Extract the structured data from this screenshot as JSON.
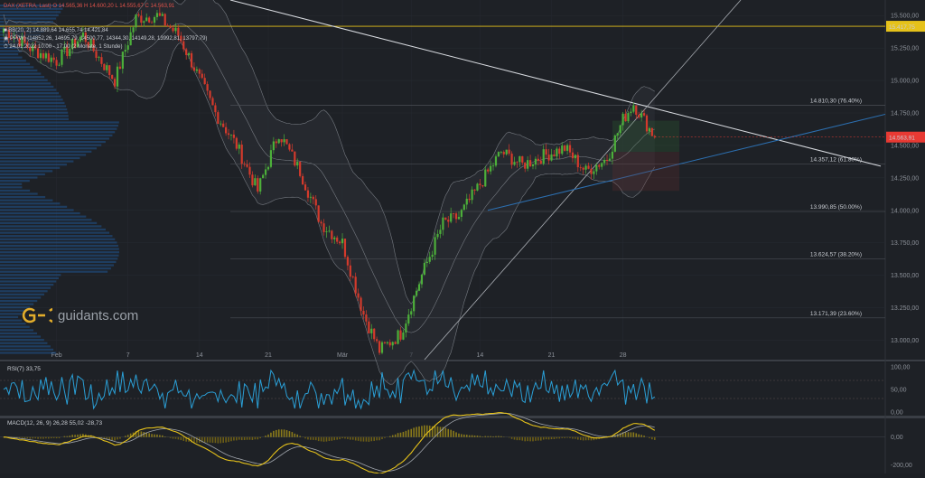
{
  "legend": {
    "symbol": "DAX (XETRA, Last)",
    "ohlc": "O 14.565,36  H 14.600,20  L 14.555,67  C 14.563,91",
    "bb": "BB(20, 2)  14.889,64  14.655,74  14.421,84",
    "pp": "PP(W)  (14852,26, 14695,79, 14500,77, 14344,30, 14149,28, 13992,81, 13797,79)",
    "range": "24.01.2022 10:00 - 17:00  (2 Monate, 1 Stunde)"
  },
  "watermark": "guidants.com",
  "colors": {
    "bull": "#4caf3a",
    "bear": "#d33a2c",
    "rsi": "#2a9fd6",
    "macd": "#e6c21a",
    "signal": "#9fa4ab",
    "bb": "#8b9097",
    "hline": "#e6c21a",
    "price_box": "#e83a33"
  },
  "chart_data": [
    {
      "type": "candlestick",
      "title": "DAX (XETRA, Last)",
      "ylim": [
        12850,
        15620
      ],
      "x_tick_labels": [
        "Feb",
        "7",
        "14",
        "21",
        "Mär",
        "7",
        "14",
        "21",
        "28"
      ],
      "y_tick_labels": [
        "15.500,00",
        "15.250,00",
        "15.000,00",
        "14.750,00",
        "14.500,00",
        "14.250,00",
        "14.000,00",
        "13.750,00",
        "13.500,00",
        "13.250,00",
        "13.000,00"
      ],
      "y_ticks": [
        15500,
        15250,
        15000,
        14750,
        14500,
        14250,
        14000,
        13750,
        13500,
        13250,
        13000
      ],
      "key_points": [
        {
          "i": 0,
          "v": 15400
        },
        {
          "i": 10,
          "v": 15250
        },
        {
          "i": 20,
          "v": 15150
        },
        {
          "i": 30,
          "v": 15350
        },
        {
          "i": 42,
          "v": 15000
        },
        {
          "i": 50,
          "v": 15480
        },
        {
          "i": 58,
          "v": 15500
        },
        {
          "i": 66,
          "v": 15350
        },
        {
          "i": 72,
          "v": 15100
        },
        {
          "i": 80,
          "v": 14750
        },
        {
          "i": 88,
          "v": 14500
        },
        {
          "i": 96,
          "v": 14150
        },
        {
          "i": 104,
          "v": 14600
        },
        {
          "i": 112,
          "v": 14300
        },
        {
          "i": 120,
          "v": 13900
        },
        {
          "i": 128,
          "v": 13750
        },
        {
          "i": 136,
          "v": 13200
        },
        {
          "i": 142,
          "v": 12920
        },
        {
          "i": 150,
          "v": 13050
        },
        {
          "i": 158,
          "v": 13500
        },
        {
          "i": 166,
          "v": 13900
        },
        {
          "i": 172,
          "v": 13950
        },
        {
          "i": 180,
          "v": 14200
        },
        {
          "i": 188,
          "v": 14450
        },
        {
          "i": 196,
          "v": 14350
        },
        {
          "i": 204,
          "v": 14420
        },
        {
          "i": 212,
          "v": 14480
        },
        {
          "i": 220,
          "v": 14300
        },
        {
          "i": 228,
          "v": 14400
        },
        {
          "i": 234,
          "v": 14700
        },
        {
          "i": 238,
          "v": 14820
        },
        {
          "i": 246,
          "v": 14564
        }
      ],
      "hlines": [
        {
          "label": "15.417,75",
          "value": 15417.75
        }
      ],
      "fib_levels": [
        {
          "label": "14.810,30 (76.40%)",
          "value": 14810.3
        },
        {
          "label": "14.357,12 (61.80%)",
          "value": 14357.12
        },
        {
          "label": "13.990,85 (50.00%)",
          "value": 13990.85
        },
        {
          "label": "13.624,57 (38.20%)",
          "value": 13624.57
        },
        {
          "label": "13.171,39 (23.60%)",
          "value": 13171.39
        }
      ],
      "last_price": {
        "label": "14.563,91",
        "value": 14563.91
      }
    },
    {
      "type": "line",
      "title": "RSI(7)  33,75",
      "series": [
        {
          "name": "RSI(7)",
          "last": 33.75
        }
      ],
      "ylim": [
        0,
        100
      ],
      "y_tick_labels": [
        "100,00",
        "50,00",
        "0,00"
      ],
      "y_ticks": [
        100,
        50,
        0
      ]
    },
    {
      "type": "line",
      "title": "MACD(12, 26, 9)  26,28  55,02  -28,73",
      "series": [
        {
          "name": "MACD",
          "last": 26.28
        },
        {
          "name": "Signal",
          "last": 55.02
        },
        {
          "name": "Histogram",
          "last": -28.73
        }
      ],
      "ylim": [
        -260,
        140
      ],
      "y_tick_labels": [
        "0,00",
        "-200,00"
      ],
      "y_ticks": [
        0,
        -200
      ]
    }
  ]
}
